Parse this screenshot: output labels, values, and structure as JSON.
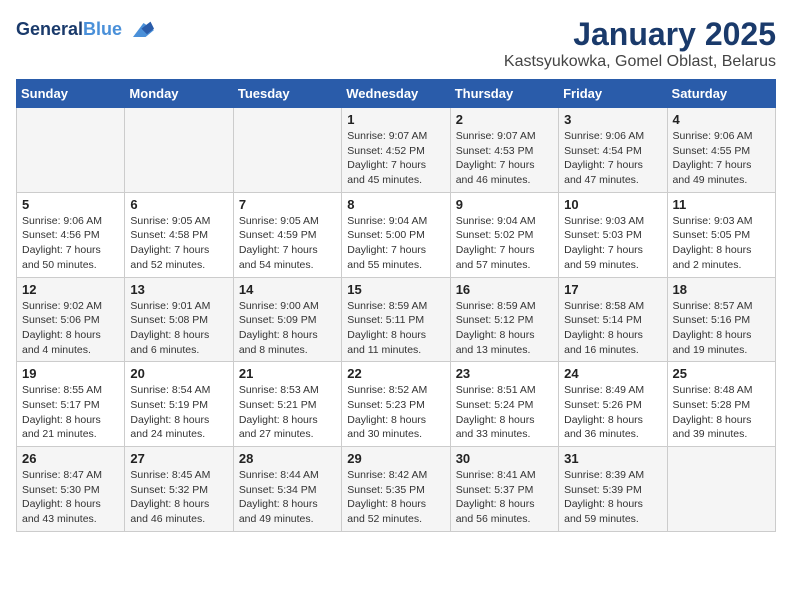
{
  "header": {
    "logo_line1": "General",
    "logo_line2": "Blue",
    "title": "January 2025",
    "subtitle": "Kastsyukowka, Gomel Oblast, Belarus"
  },
  "weekdays": [
    "Sunday",
    "Monday",
    "Tuesday",
    "Wednesday",
    "Thursday",
    "Friday",
    "Saturday"
  ],
  "weeks": [
    [
      {
        "day": "",
        "info": ""
      },
      {
        "day": "",
        "info": ""
      },
      {
        "day": "",
        "info": ""
      },
      {
        "day": "1",
        "info": "Sunrise: 9:07 AM\nSunset: 4:52 PM\nDaylight: 7 hours and 45 minutes."
      },
      {
        "day": "2",
        "info": "Sunrise: 9:07 AM\nSunset: 4:53 PM\nDaylight: 7 hours and 46 minutes."
      },
      {
        "day": "3",
        "info": "Sunrise: 9:06 AM\nSunset: 4:54 PM\nDaylight: 7 hours and 47 minutes."
      },
      {
        "day": "4",
        "info": "Sunrise: 9:06 AM\nSunset: 4:55 PM\nDaylight: 7 hours and 49 minutes."
      }
    ],
    [
      {
        "day": "5",
        "info": "Sunrise: 9:06 AM\nSunset: 4:56 PM\nDaylight: 7 hours and 50 minutes."
      },
      {
        "day": "6",
        "info": "Sunrise: 9:05 AM\nSunset: 4:58 PM\nDaylight: 7 hours and 52 minutes."
      },
      {
        "day": "7",
        "info": "Sunrise: 9:05 AM\nSunset: 4:59 PM\nDaylight: 7 hours and 54 minutes."
      },
      {
        "day": "8",
        "info": "Sunrise: 9:04 AM\nSunset: 5:00 PM\nDaylight: 7 hours and 55 minutes."
      },
      {
        "day": "9",
        "info": "Sunrise: 9:04 AM\nSunset: 5:02 PM\nDaylight: 7 hours and 57 minutes."
      },
      {
        "day": "10",
        "info": "Sunrise: 9:03 AM\nSunset: 5:03 PM\nDaylight: 7 hours and 59 minutes."
      },
      {
        "day": "11",
        "info": "Sunrise: 9:03 AM\nSunset: 5:05 PM\nDaylight: 8 hours and 2 minutes."
      }
    ],
    [
      {
        "day": "12",
        "info": "Sunrise: 9:02 AM\nSunset: 5:06 PM\nDaylight: 8 hours and 4 minutes."
      },
      {
        "day": "13",
        "info": "Sunrise: 9:01 AM\nSunset: 5:08 PM\nDaylight: 8 hours and 6 minutes."
      },
      {
        "day": "14",
        "info": "Sunrise: 9:00 AM\nSunset: 5:09 PM\nDaylight: 8 hours and 8 minutes."
      },
      {
        "day": "15",
        "info": "Sunrise: 8:59 AM\nSunset: 5:11 PM\nDaylight: 8 hours and 11 minutes."
      },
      {
        "day": "16",
        "info": "Sunrise: 8:59 AM\nSunset: 5:12 PM\nDaylight: 8 hours and 13 minutes."
      },
      {
        "day": "17",
        "info": "Sunrise: 8:58 AM\nSunset: 5:14 PM\nDaylight: 8 hours and 16 minutes."
      },
      {
        "day": "18",
        "info": "Sunrise: 8:57 AM\nSunset: 5:16 PM\nDaylight: 8 hours and 19 minutes."
      }
    ],
    [
      {
        "day": "19",
        "info": "Sunrise: 8:55 AM\nSunset: 5:17 PM\nDaylight: 8 hours and 21 minutes."
      },
      {
        "day": "20",
        "info": "Sunrise: 8:54 AM\nSunset: 5:19 PM\nDaylight: 8 hours and 24 minutes."
      },
      {
        "day": "21",
        "info": "Sunrise: 8:53 AM\nSunset: 5:21 PM\nDaylight: 8 hours and 27 minutes."
      },
      {
        "day": "22",
        "info": "Sunrise: 8:52 AM\nSunset: 5:23 PM\nDaylight: 8 hours and 30 minutes."
      },
      {
        "day": "23",
        "info": "Sunrise: 8:51 AM\nSunset: 5:24 PM\nDaylight: 8 hours and 33 minutes."
      },
      {
        "day": "24",
        "info": "Sunrise: 8:49 AM\nSunset: 5:26 PM\nDaylight: 8 hours and 36 minutes."
      },
      {
        "day": "25",
        "info": "Sunrise: 8:48 AM\nSunset: 5:28 PM\nDaylight: 8 hours and 39 minutes."
      }
    ],
    [
      {
        "day": "26",
        "info": "Sunrise: 8:47 AM\nSunset: 5:30 PM\nDaylight: 8 hours and 43 minutes."
      },
      {
        "day": "27",
        "info": "Sunrise: 8:45 AM\nSunset: 5:32 PM\nDaylight: 8 hours and 46 minutes."
      },
      {
        "day": "28",
        "info": "Sunrise: 8:44 AM\nSunset: 5:34 PM\nDaylight: 8 hours and 49 minutes."
      },
      {
        "day": "29",
        "info": "Sunrise: 8:42 AM\nSunset: 5:35 PM\nDaylight: 8 hours and 52 minutes."
      },
      {
        "day": "30",
        "info": "Sunrise: 8:41 AM\nSunset: 5:37 PM\nDaylight: 8 hours and 56 minutes."
      },
      {
        "day": "31",
        "info": "Sunrise: 8:39 AM\nSunset: 5:39 PM\nDaylight: 8 hours and 59 minutes."
      },
      {
        "day": "",
        "info": ""
      }
    ]
  ]
}
